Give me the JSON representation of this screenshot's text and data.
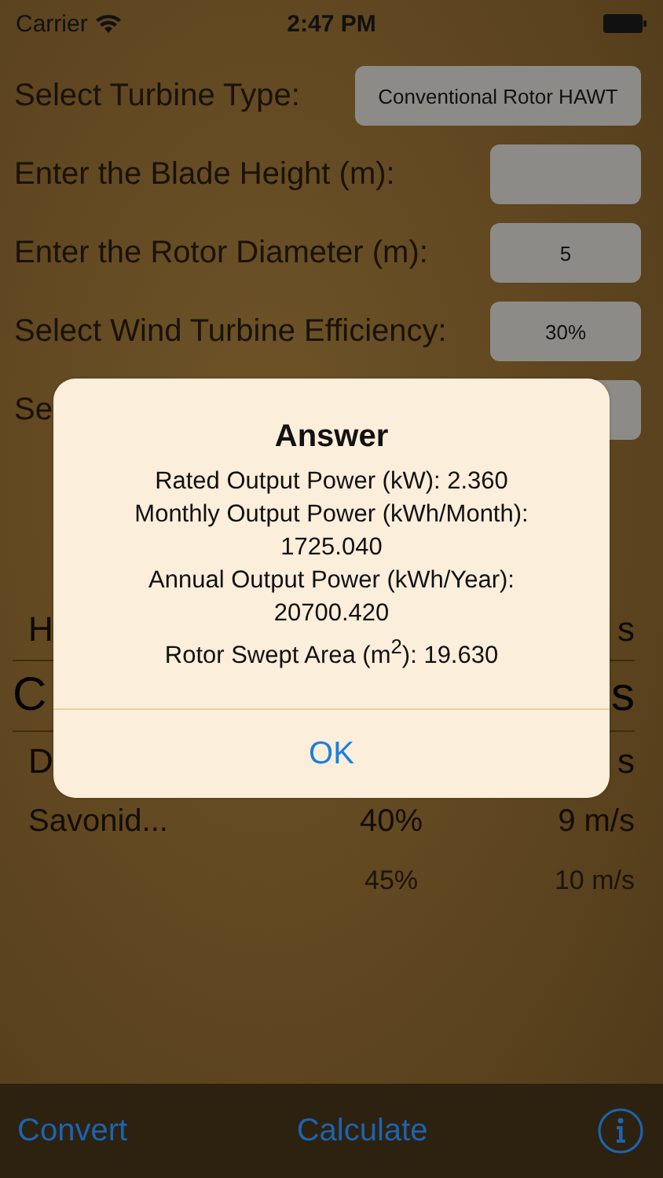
{
  "status_bar": {
    "carrier": "Carrier",
    "time": "2:47 PM"
  },
  "form": [
    {
      "label": "Select Turbine Type:",
      "value": "Conventional Rotor HAWT",
      "kind": "wide"
    },
    {
      "label": "Enter the Blade Height (m):",
      "kind": "narrow"
    },
    {
      "label": "Enter the Rotor Diameter (m):",
      "value": "5",
      "kind": "narrow"
    },
    {
      "label": "Select Wind Turbine Efficiency:",
      "value": "30%",
      "kind": "narrow"
    },
    {
      "label": "Se",
      "kind": "narrow"
    }
  ],
  "picker": {
    "rows": [
      {
        "kind": "near",
        "column_1": "H",
        "column_3": "s"
      },
      {
        "kind": "center",
        "column_1": "C",
        "column_3": "s"
      },
      {
        "kind": "near",
        "column_1": "D",
        "column_3": "s"
      },
      {
        "kind": "far",
        "column_1": "Savonid...",
        "column_2": "40%",
        "column_3": "9 m/s"
      },
      {
        "kind": "farthest",
        "column_2": "45%",
        "column_3": "10 m/s"
      }
    ]
  },
  "alert": {
    "title": "Answer",
    "lines": [
      "Rated Output Power (kW): 2.360",
      "Monthly Output Power (kWh/Month):",
      "1725.040",
      "Annual Output Power (kWh/Year):",
      "20700.420",
      "Rotor Swept Area (m$^{2}$): 19.630"
    ],
    "button": "OK"
  },
  "toolbar": {
    "left": "Convert",
    "center": "Calculate"
  }
}
